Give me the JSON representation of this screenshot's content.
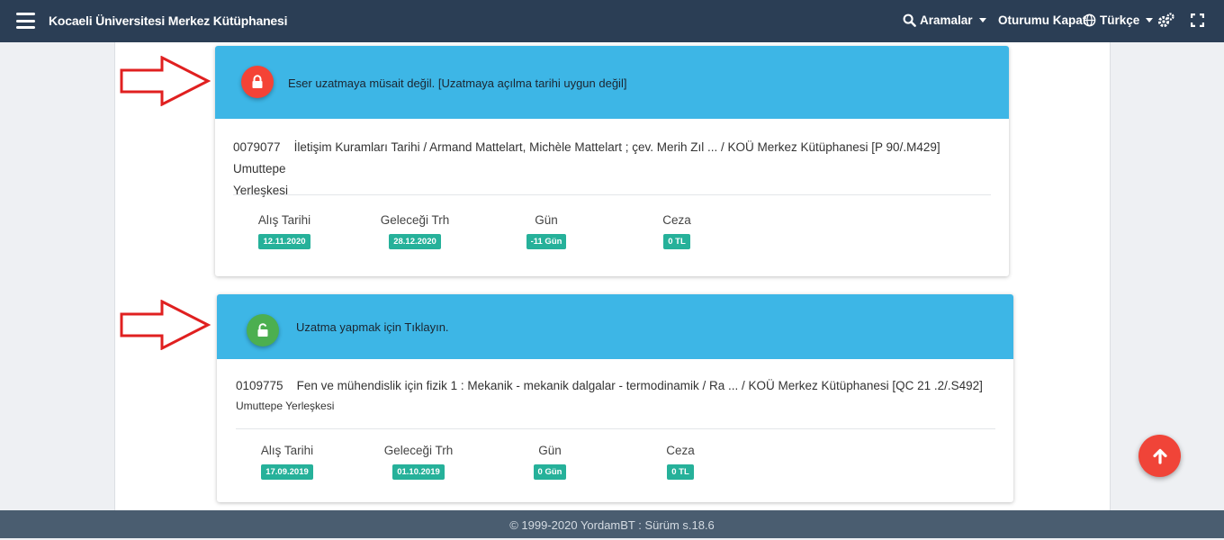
{
  "header": {
    "title": "Kocaeli Üniversitesi Merkez Kütüphanesi",
    "searches_label": "Aramalar",
    "logout_label": "Oturumu Kapat",
    "language_label": "Türkçe",
    "menu_icon": "hamburger-menu-icon",
    "search_icon": "search-icon",
    "globe_icon": "globe-icon",
    "settings_icon": "gears-icon",
    "fullscreen_icon": "fullscreen-icon"
  },
  "loans": [
    {
      "status_text": "Eser uzatmaya müsait değil. [Uzatmaya açılma tarihi uygun değil]",
      "status_icon": "lock-icon",
      "status_color": "#f44336",
      "barcode": "0079077",
      "title_line1": "İletişim Kuramları Tarihi / Armand Mattelart, Michèle Mattelart ; çev. Merih Zıl ... / KOÜ Merkez Kütüphanesi [P 90/.M429] Umuttepe",
      "title_line2": "Yerleşkesi",
      "labels": {
        "issue": "Alış Tarihi",
        "due": "Geleceği Trh",
        "days": "Gün",
        "fine": "Ceza"
      },
      "issue_date": "12.11.2020",
      "due_date": "28.12.2020",
      "days": "-11 Gün",
      "fine": "0 TL"
    },
    {
      "status_text": "Uzatma yapmak için Tıklayın.",
      "status_icon": "unlock-icon",
      "status_color": "#4caf50",
      "barcode": "0109775",
      "title_line1": "Fen ve mühendislik için fizik 1 : Mekanik - mekanik dalgalar - termodinamik / Ra ... / KOÜ Merkez Kütüphanesi [QC 21 .2/.S492]",
      "title_line2": "Umuttepe Yerleşkesi",
      "labels": {
        "issue": "Alış Tarihi",
        "due": "Geleceği Trh",
        "days": "Gün",
        "fine": "Ceza"
      },
      "issue_date": "17.09.2019",
      "due_date": "01.10.2019",
      "days": "0 Gün",
      "fine": "0 TL"
    }
  ],
  "fab_icon": "arrow-up-icon",
  "annotation_arrow_color": "#e02020",
  "footer": {
    "text": "© 1999-2020 YordamBT : Sürüm s.18.6"
  }
}
